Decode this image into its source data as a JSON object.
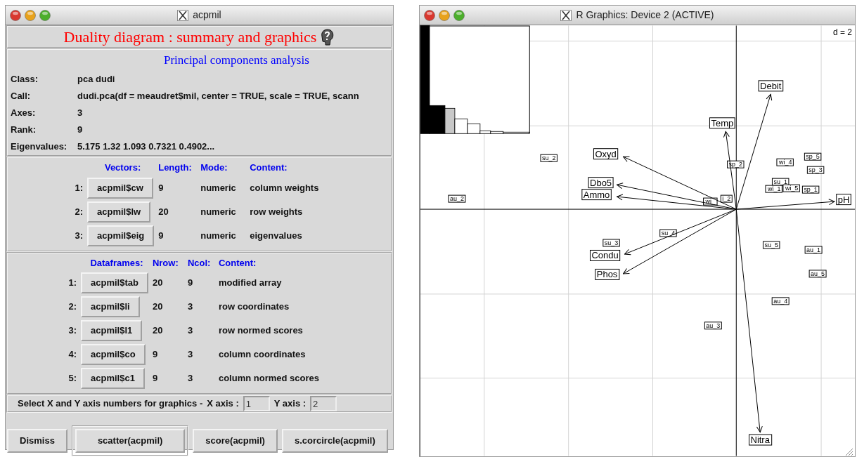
{
  "left_window": {
    "title": "acpmil",
    "heading": "Duality diagram : summary and graphics",
    "subtitle": "Principal components analysis",
    "info": [
      {
        "label": "Class:",
        "value": "pca dudi"
      },
      {
        "label": "Call:",
        "value": "dudi.pca(df = meaudret$mil, center = TRUE, scale = TRUE, scann"
      },
      {
        "label": "Axes:",
        "value": "3"
      },
      {
        "label": "Rank:",
        "value": "9"
      },
      {
        "label": "Eigenvalues:",
        "value": "5.175 1.32 1.093 0.7321 0.4902..."
      }
    ],
    "vectors": {
      "columns": [
        "Vectors:",
        "Length:",
        "Mode:",
        "Content:"
      ],
      "rows": [
        {
          "index": "1:",
          "button": "acpmil$cw",
          "length": "9",
          "mode": "numeric",
          "content": "column weights"
        },
        {
          "index": "2:",
          "button": "acpmil$lw",
          "length": "20",
          "mode": "numeric",
          "content": "row weights"
        },
        {
          "index": "3:",
          "button": "acpmil$eig",
          "length": "9",
          "mode": "numeric",
          "content": "eigenvalues"
        }
      ]
    },
    "dataframes": {
      "columns": [
        "Dataframes:",
        "Nrow:",
        "Ncol:",
        "Content:"
      ],
      "rows": [
        {
          "index": "1:",
          "button": "acpmil$tab",
          "nrow": "20",
          "ncol": "9",
          "content": "modified array"
        },
        {
          "index": "2:",
          "button": "acpmil$li",
          "nrow": "20",
          "ncol": "3",
          "content": "row coordinates"
        },
        {
          "index": "3:",
          "button": "acpmil$l1",
          "nrow": "20",
          "ncol": "3",
          "content": "row normed scores"
        },
        {
          "index": "4:",
          "button": "acpmil$co",
          "nrow": "9",
          "ncol": "3",
          "content": "column coordinates"
        },
        {
          "index": "5:",
          "button": "acpmil$c1",
          "nrow": "9",
          "ncol": "3",
          "content": "column normed scores"
        }
      ]
    },
    "axis_select": {
      "prompt": "Select X and Y axis numbers for graphics -",
      "x_label": "X axis :",
      "x_value": "1",
      "y_label": "Y axis :",
      "y_value": "2"
    },
    "buttons": [
      {
        "label": "Dismiss",
        "default": false
      },
      {
        "label": "scatter(acpmil)",
        "default": true
      },
      {
        "label": "score(acpmil)",
        "default": false
      },
      {
        "label": "s.corcircle(acpmil)",
        "default": false
      }
    ]
  },
  "right_window": {
    "title": "R Graphics: Device 2 (ACTIVE)",
    "scale_label": "d = 2",
    "variables": [
      "Debit",
      "Temp",
      "Oxyd",
      "Dbo5",
      "Ammo",
      "pH",
      "Condu",
      "Phos",
      "Nitra"
    ],
    "samples": [
      "su_2",
      "au_2",
      "sp_2",
      "wi_4",
      "sp_5",
      "sp_3",
      "su_1",
      "wi_1",
      "wi_5",
      "sp_1",
      "i_2",
      "wi_",
      "su_3",
      "su_4",
      "su_5",
      "au_1",
      "au_5",
      "au_4",
      "au_3"
    ]
  }
}
